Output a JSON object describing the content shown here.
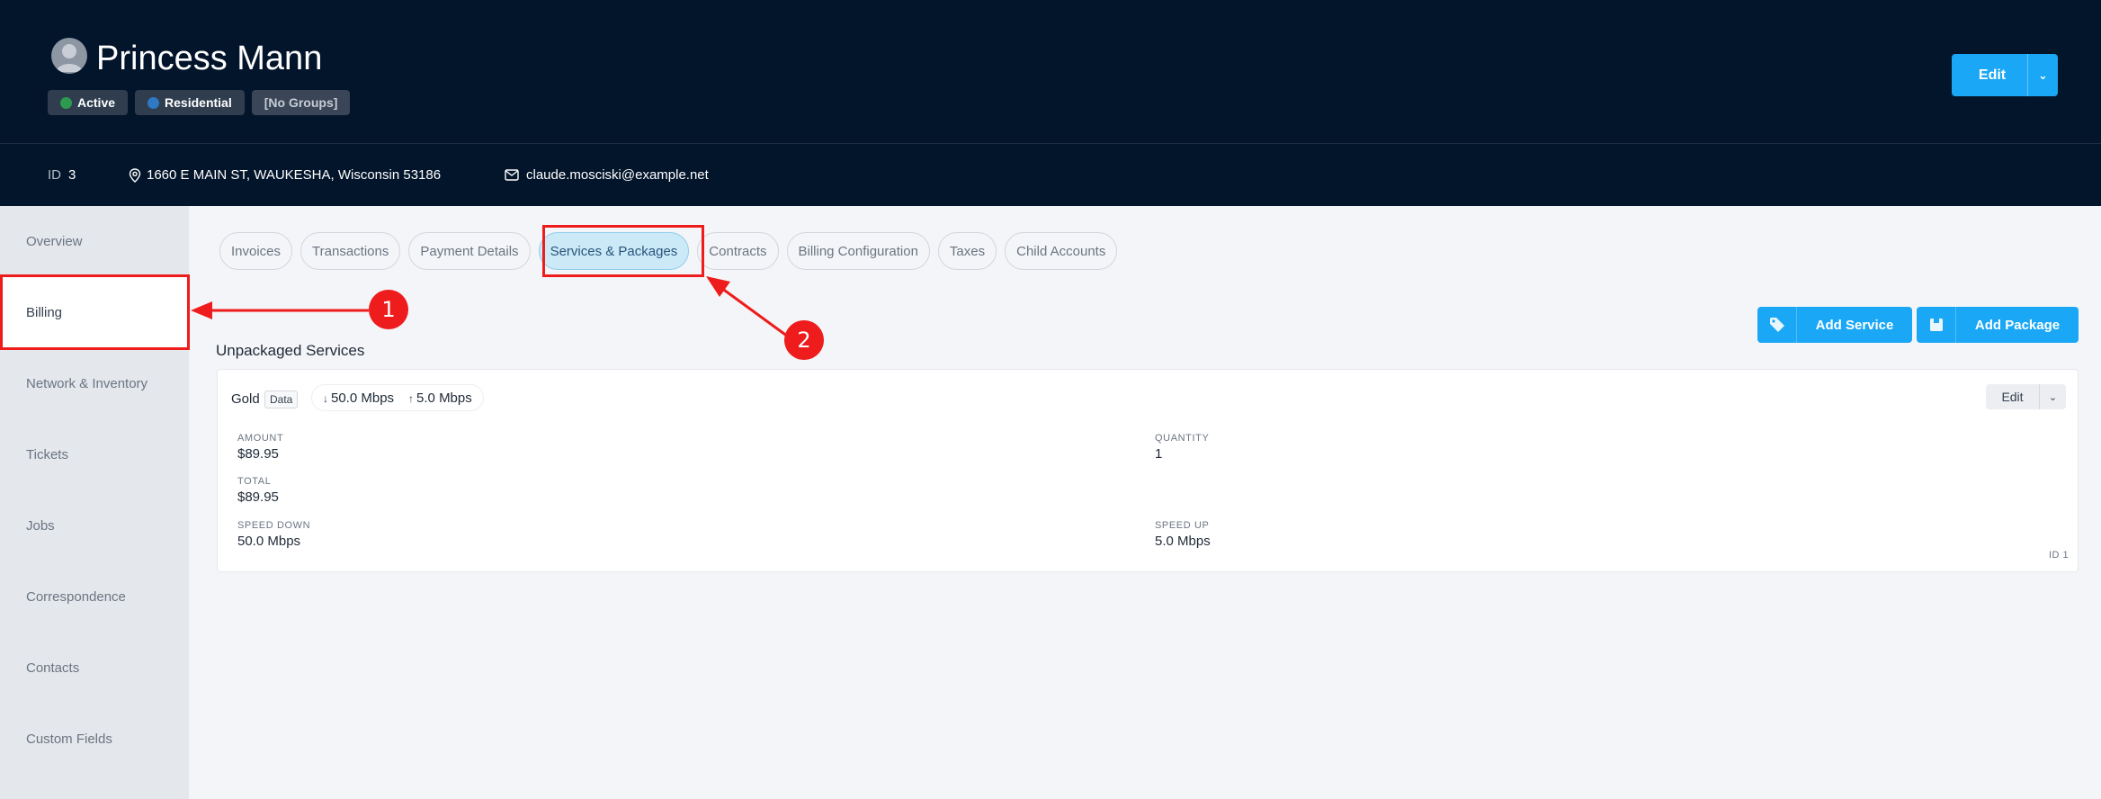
{
  "customer": {
    "name": "Princess Mann",
    "badges": [
      {
        "label": "Active",
        "dot_color": "#2e9a4f"
      },
      {
        "label": "Residential",
        "dot_color": "#2f78c4"
      },
      {
        "label": "[No Groups]"
      }
    ],
    "edit_label": "Edit",
    "id_label": "ID",
    "id_value": "3",
    "address": "1660 E MAIN ST, WAUKESHA, Wisconsin 53186",
    "email": "claude.mosciski@example.net"
  },
  "sidebar": {
    "items": [
      {
        "label": "Overview"
      },
      {
        "label": "Billing"
      },
      {
        "label": "Network & Inventory"
      },
      {
        "label": "Tickets"
      },
      {
        "label": "Jobs"
      },
      {
        "label": "Correspondence"
      },
      {
        "label": "Contacts"
      },
      {
        "label": "Custom Fields"
      }
    ],
    "active": "Billing"
  },
  "tabs": [
    {
      "label": "Invoices"
    },
    {
      "label": "Transactions"
    },
    {
      "label": "Payment Details"
    },
    {
      "label": "Services & Packages"
    },
    {
      "label": "Contracts"
    },
    {
      "label": "Billing Configuration"
    },
    {
      "label": "Taxes"
    },
    {
      "label": "Child Accounts"
    }
  ],
  "active_tab": "Services & Packages",
  "actions": {
    "add_service": "Add Service",
    "add_package": "Add Package"
  },
  "section_title": "Unpackaged Services",
  "service": {
    "name": "Gold",
    "type": "Data",
    "speed_down": "50.0 Mbps",
    "speed_up": "5.0 Mbps",
    "edit_label": "Edit",
    "fields": {
      "amount_label": "AMOUNT",
      "amount": "$89.95",
      "quantity_label": "QUANTITY",
      "quantity": "1",
      "total_label": "TOTAL",
      "total": "$89.95",
      "speed_down_label": "SPEED DOWN",
      "speed_down": "50.0 Mbps",
      "speed_up_label": "SPEED UP",
      "speed_up": "5.0 Mbps"
    },
    "id_text": "ID 1"
  },
  "annotations": {
    "marker_1": "1",
    "marker_2": "2",
    "color": "#ee1c1c"
  },
  "colors": {
    "header_bg": "#03152b",
    "accent": "#1aa7f5",
    "active_tab_bg": "#cce9f8"
  }
}
